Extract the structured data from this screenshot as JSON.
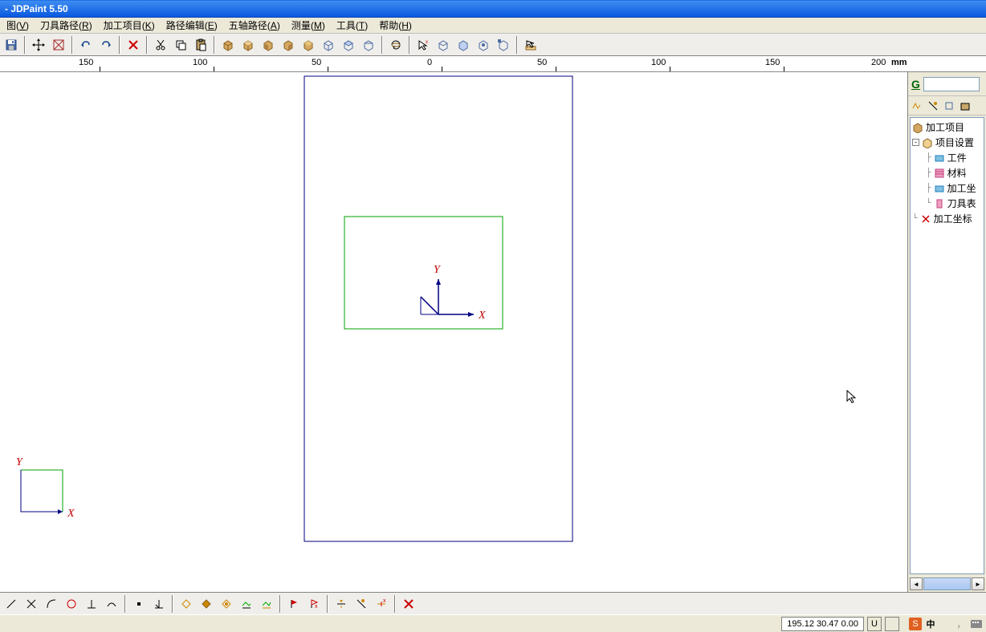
{
  "title": "- JDPaint 5.50",
  "menu": {
    "items": [
      {
        "label": "图",
        "key": "V"
      },
      {
        "label": "刀具路径",
        "key": "R"
      },
      {
        "label": "加工项目",
        "key": "K"
      },
      {
        "label": "路径编辑",
        "key": "E"
      },
      {
        "label": "五轴路径",
        "key": "A"
      },
      {
        "label": "测量",
        "key": "M"
      },
      {
        "label": "工具",
        "key": "T"
      },
      {
        "label": "帮助",
        "key": "H"
      }
    ]
  },
  "ruler": {
    "unit": "mm",
    "ticks": [
      "150",
      "100",
      "50",
      "0",
      "50",
      "100",
      "150",
      "200"
    ]
  },
  "tree": {
    "root": "加工项目",
    "settings": "项目设置",
    "children": [
      "工件",
      "材料",
      "加工坐",
      "刀具表"
    ],
    "coords": "加工坐标"
  },
  "side": {
    "g_label": "G"
  },
  "status": {
    "coords": "195.12 30.47 0.00",
    "u": "U"
  },
  "ime": {
    "s": "S",
    "zh": "中"
  },
  "axis": {
    "x": "X",
    "y": "Y"
  }
}
